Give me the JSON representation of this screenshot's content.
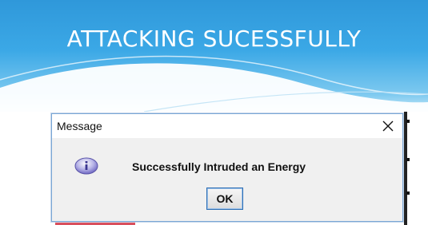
{
  "slide": {
    "title": "ATTACKING SUCESSFULLY"
  },
  "dialog": {
    "title": "Message",
    "message": "Successfully Intruded an Energy",
    "ok_label": "OK",
    "close_glyph": "✕",
    "icon": "info-icon"
  },
  "colors": {
    "header_blue": "#2f98da",
    "dialog_bg": "#f0f0f0",
    "dialog_border": "#7aa7d6",
    "accent_red": "#d94f5c"
  }
}
